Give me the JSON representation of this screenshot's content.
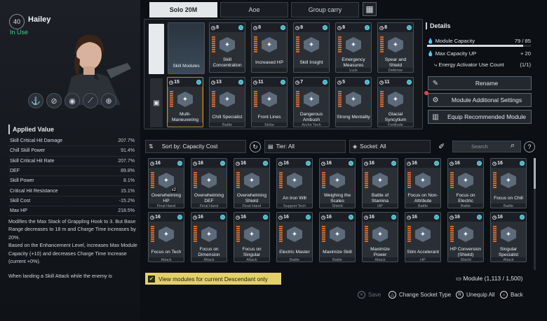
{
  "character": {
    "level": "40",
    "name": "Hailey",
    "status": "In Use",
    "skill_icons": [
      "grapple-icon",
      "shield-slash-icon",
      "eye-icon",
      "sniper-icon",
      "crosshair-icon"
    ]
  },
  "applied_value": {
    "title": "Applied Value",
    "stats": [
      {
        "label": "Skill Critical Hit Damage",
        "value": "207.7%"
      },
      {
        "label": "Chill Skill Power",
        "value": "91.4%"
      },
      {
        "label": "Skill Critical Hit Rate",
        "value": "207.7%"
      },
      {
        "label": "DEF",
        "value": "89.8%"
      },
      {
        "label": "Skill Power",
        "value": "8.1%"
      },
      {
        "label": "Critical Hit Resistance",
        "value": "15.1%"
      },
      {
        "label": "Skill Cost",
        "value": "-15.2%"
      },
      {
        "label": "Max HP",
        "value": "218.5%"
      }
    ],
    "description": [
      "Modifies the Max Stack of Grappling Hook to 3. But Base Range decreases to 18 m and Charge Time increases by 20%.",
      "Based on the Enhancement Level, increases Max Module Capacity (+10) and decreases Charge Time Increase (current +0%)."
    ],
    "description2": "When landing a Skill Attack while the enemy is"
  },
  "tabs": [
    "Solo 20M",
    "Aoe",
    "Group carry"
  ],
  "equipped": {
    "slot1": {
      "label": "Skill Modules"
    },
    "row1": [
      {
        "cost": "8",
        "name": "Skill Concentration",
        "sub": ""
      },
      {
        "cost": "8",
        "name": "Increased HP",
        "sub": ""
      },
      {
        "cost": "8",
        "name": "Skill Insight",
        "sub": ""
      },
      {
        "cost": "8",
        "name": "Emergency Measures",
        "sub": "Luck"
      },
      {
        "cost": "8",
        "name": "Spear and Shield",
        "sub": "Defense"
      }
    ],
    "row2": [
      {
        "cost": "15",
        "name": "Multi-Maneuvering",
        "sub": ""
      },
      {
        "cost": "13",
        "name": "Chill Specialist",
        "sub": "Battle"
      },
      {
        "cost": "11",
        "name": "Front Lines",
        "sub": "Strike"
      },
      {
        "cost": "7",
        "name": "Dangerous Ambush",
        "sub": "Arche Tech"
      },
      {
        "cost": "5",
        "name": "Strong Mentality",
        "sub": ""
      },
      {
        "cost": "11",
        "name": "Glacial Syncytium",
        "sub": "Fortitude"
      }
    ]
  },
  "details": {
    "title": "Details",
    "capacity_label": "Module Capacity",
    "capacity_value": "79 / 85",
    "capacity_fraction": 0.929,
    "max_cap_label": "Max Capacity UP",
    "max_cap_value": "+ 20",
    "activator_label": "Energy Activator Use Count",
    "activator_value": "(1/1)",
    "rename": "Rename",
    "additional": "Module Additional Settings",
    "recommend": "Equip Recommended Module"
  },
  "filters": {
    "sort": "Sort by: Capacity Cost",
    "tier": "Tier: All",
    "socket": "Socket: All",
    "search_placeholder": "Search"
  },
  "modules": [
    {
      "cost": "16",
      "name": "Overwhelming HP",
      "sub": "Final Hand",
      "x": "x2"
    },
    {
      "cost": "16",
      "name": "Overwhelming DEF",
      "sub": "Final Hand"
    },
    {
      "cost": "16",
      "name": "Overwhelming Shield",
      "sub": "Final Hand"
    },
    {
      "cost": "16",
      "name": "An Iron Will",
      "sub": "Support Tech"
    },
    {
      "cost": "16",
      "name": "Weighing the Scales",
      "sub": "Shield"
    },
    {
      "cost": "16",
      "name": "Battle of Stamina",
      "sub": "HP"
    },
    {
      "cost": "16",
      "name": "Focus on Non-Attribute",
      "sub": "Battle"
    },
    {
      "cost": "16",
      "name": "Focus on Electric",
      "sub": "Battle"
    },
    {
      "cost": "16",
      "name": "Focus on Chill",
      "sub": "Battle"
    },
    {
      "cost": "16",
      "name": "Focus on Tech",
      "sub": "Attack"
    },
    {
      "cost": "16",
      "name": "Focus on Dimension",
      "sub": "Attack"
    },
    {
      "cost": "16",
      "name": "Focus on Singular",
      "sub": "Attack"
    },
    {
      "cost": "16",
      "name": "Electric Master",
      "sub": "Battle"
    },
    {
      "cost": "16",
      "name": "Maximize Skill",
      "sub": "Battle"
    },
    {
      "cost": "16",
      "name": "Maximize Power",
      "sub": "Attack"
    },
    {
      "cost": "16",
      "name": "Stim Accelerant",
      "sub": "HP"
    },
    {
      "cost": "16",
      "name": "HP Conversion (Shield)",
      "sub": "Shield"
    },
    {
      "cost": "16",
      "name": "Singular Specialist",
      "sub": "Attack"
    }
  ],
  "footer": {
    "view_current": "View modules for current Descendant only",
    "module_label": "Module",
    "module_count": "(1,113 / 1,500)",
    "save": "Save",
    "change_socket": "Change Socket Type",
    "unequip_all": "Unequip All",
    "back": "Back"
  }
}
